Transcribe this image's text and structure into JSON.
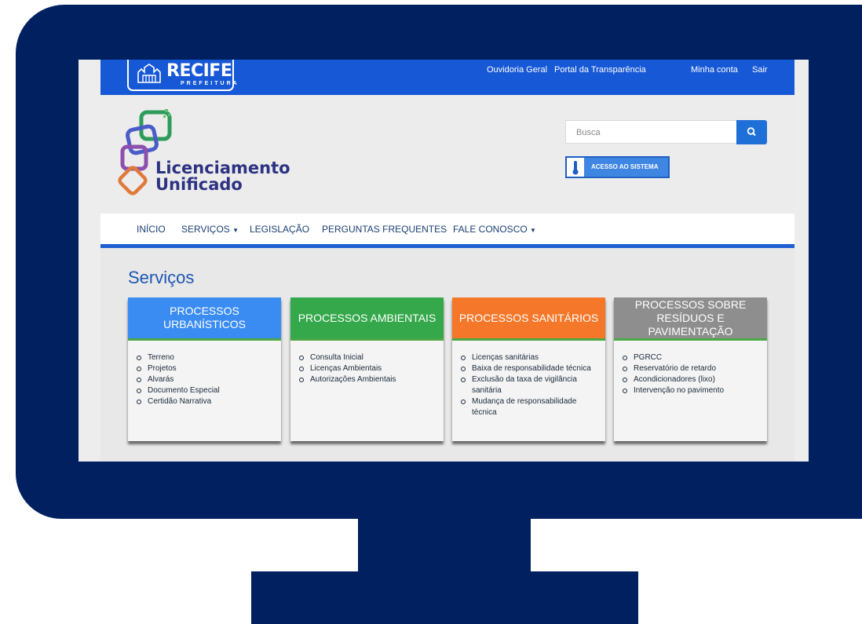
{
  "colors": {
    "frame": "#002060",
    "top_bar": "#1758d6",
    "card_urbanisticos": "#3b8cf2",
    "card_ambientais": "#34a84a",
    "card_sanitarios": "#f5782a",
    "card_residuos": "#8e8e8e"
  },
  "brand": {
    "prefeitura_name": "RECIFE",
    "prefeitura_sub": "PREFEITURA",
    "product_line1": "Licenciamento",
    "product_line2": "Unificado"
  },
  "top_links": [
    "Ouvidoria Geral",
    "Portal da Transparência",
    "Minha conta",
    "Sair"
  ],
  "search": {
    "placeholder": "Busca",
    "icon": "search-icon"
  },
  "acesso_button": "ACESSO AO SISTEMA",
  "nav": [
    "INÍCIO",
    "SERVIÇOS",
    "LEGISLAÇÃO",
    "PERGUNTAS FREQUENTES",
    "FALE CONOSCO"
  ],
  "page_title": "Serviços",
  "cards": [
    {
      "title": "PROCESSOS URBANÍSTICOS",
      "items": [
        "Terreno",
        "Projetos",
        "Alvarás",
        "Documento Especial",
        "Certidão Narrativa"
      ]
    },
    {
      "title": "PROCESSOS AMBIENTAIS",
      "items": [
        "Consulta Inicial",
        "Licenças Ambientais",
        "Autorizações Ambientais"
      ]
    },
    {
      "title": "PROCESSOS SANITÁRIOS",
      "items": [
        "Licenças sanitárias",
        "Baixa de responsabilidade técnica",
        "Exclusão da taxa de vigilância sanitária",
        "Mudança de responsabilidade técnica"
      ]
    },
    {
      "title_line1": "PROCESSOS SOBRE",
      "title_line2": "RESÍDUOS E PAVIMENTAÇÃO",
      "items": [
        "PGRCC",
        "Reservatório de retardo",
        "Acondicionadores (lixo)",
        "Intervenção no pavimento"
      ]
    }
  ]
}
